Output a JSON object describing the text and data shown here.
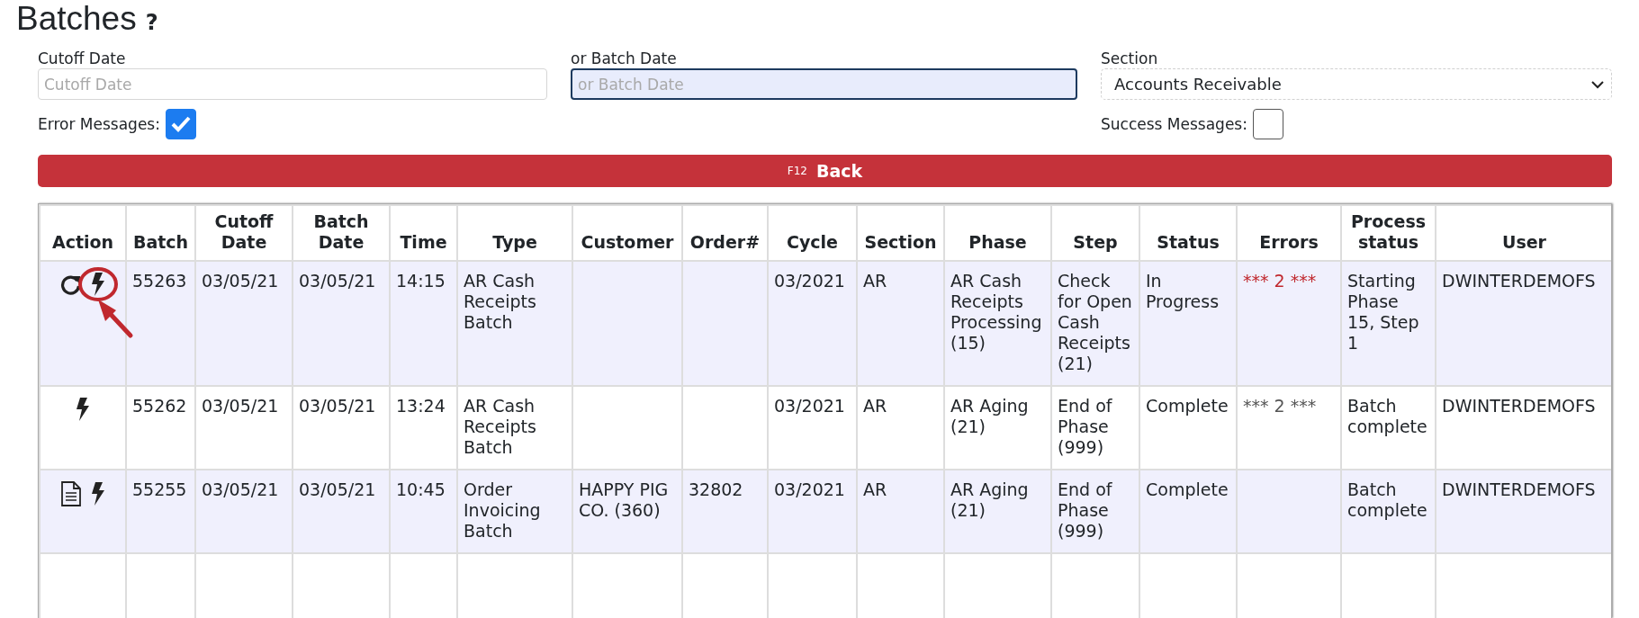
{
  "page": {
    "title": "Batches",
    "help": "?"
  },
  "filters": {
    "cutoff_date": {
      "label": "Cutoff Date",
      "placeholder": "Cutoff Date",
      "focused": false
    },
    "batch_date": {
      "label": "or Batch Date",
      "placeholder": "or Batch Date",
      "focused": true
    },
    "section": {
      "label": "Section",
      "value": "Accounts Receivable"
    },
    "error_messages": {
      "label": "Error Messages:",
      "checked": true
    },
    "success_messages": {
      "label": "Success Messages:",
      "checked": false
    }
  },
  "back_button": {
    "shortcut": "F12",
    "label": "Back"
  },
  "table": {
    "columns": [
      "Action",
      "Batch",
      "Cutoff Date",
      "Batch Date",
      "Time",
      "Type",
      "Customer",
      "Order#",
      "Cycle",
      "Section",
      "Phase",
      "Step",
      "Status",
      "Errors",
      "Process status",
      "User"
    ],
    "rows": [
      {
        "actions": [
          {
            "kind": "refresh",
            "callout": false
          },
          {
            "kind": "run",
            "callout": true
          }
        ],
        "batch": "55263",
        "cutoff_date": "03/05/21",
        "batch_date": "03/05/21",
        "time": "14:15",
        "type": "AR Cash Receipts Batch",
        "customer": "",
        "order": "",
        "cycle": "03/2021",
        "section": "AR",
        "phase": "AR Cash Receipts Processing (15)",
        "step": "Check for Open Cash Receipts (21)",
        "status": "In Progress",
        "errors": "*** 2 ***",
        "errors_active": true,
        "process_status": "Starting Phase 15, Step 1",
        "user": "DWINTERDEMOFS"
      },
      {
        "actions": [
          {
            "kind": "run",
            "callout": false
          }
        ],
        "batch": "55262",
        "cutoff_date": "03/05/21",
        "batch_date": "03/05/21",
        "time": "13:24",
        "type": "AR Cash Receipts Batch",
        "customer": "",
        "order": "",
        "cycle": "03/2021",
        "section": "AR",
        "phase": "AR Aging (21)",
        "step": "End of Phase (999)",
        "status": "Complete",
        "errors": "*** 2 ***",
        "errors_active": false,
        "process_status": "Batch complete",
        "user": "DWINTERDEMOFS"
      },
      {
        "actions": [
          {
            "kind": "document",
            "callout": false
          },
          {
            "kind": "run",
            "callout": false
          }
        ],
        "batch": "55255",
        "cutoff_date": "03/05/21",
        "batch_date": "03/05/21",
        "time": "10:45",
        "type": "Order Invoicing Batch",
        "customer": "HAPPY PIG CO. (360)",
        "order": "32802",
        "cycle": "03/2021",
        "section": "AR",
        "phase": "AR Aging (21)",
        "step": "End of Phase (999)",
        "status": "Complete",
        "errors": "",
        "process_status": "Batch complete",
        "user": "DWINTERDEMOFS"
      }
    ]
  }
}
